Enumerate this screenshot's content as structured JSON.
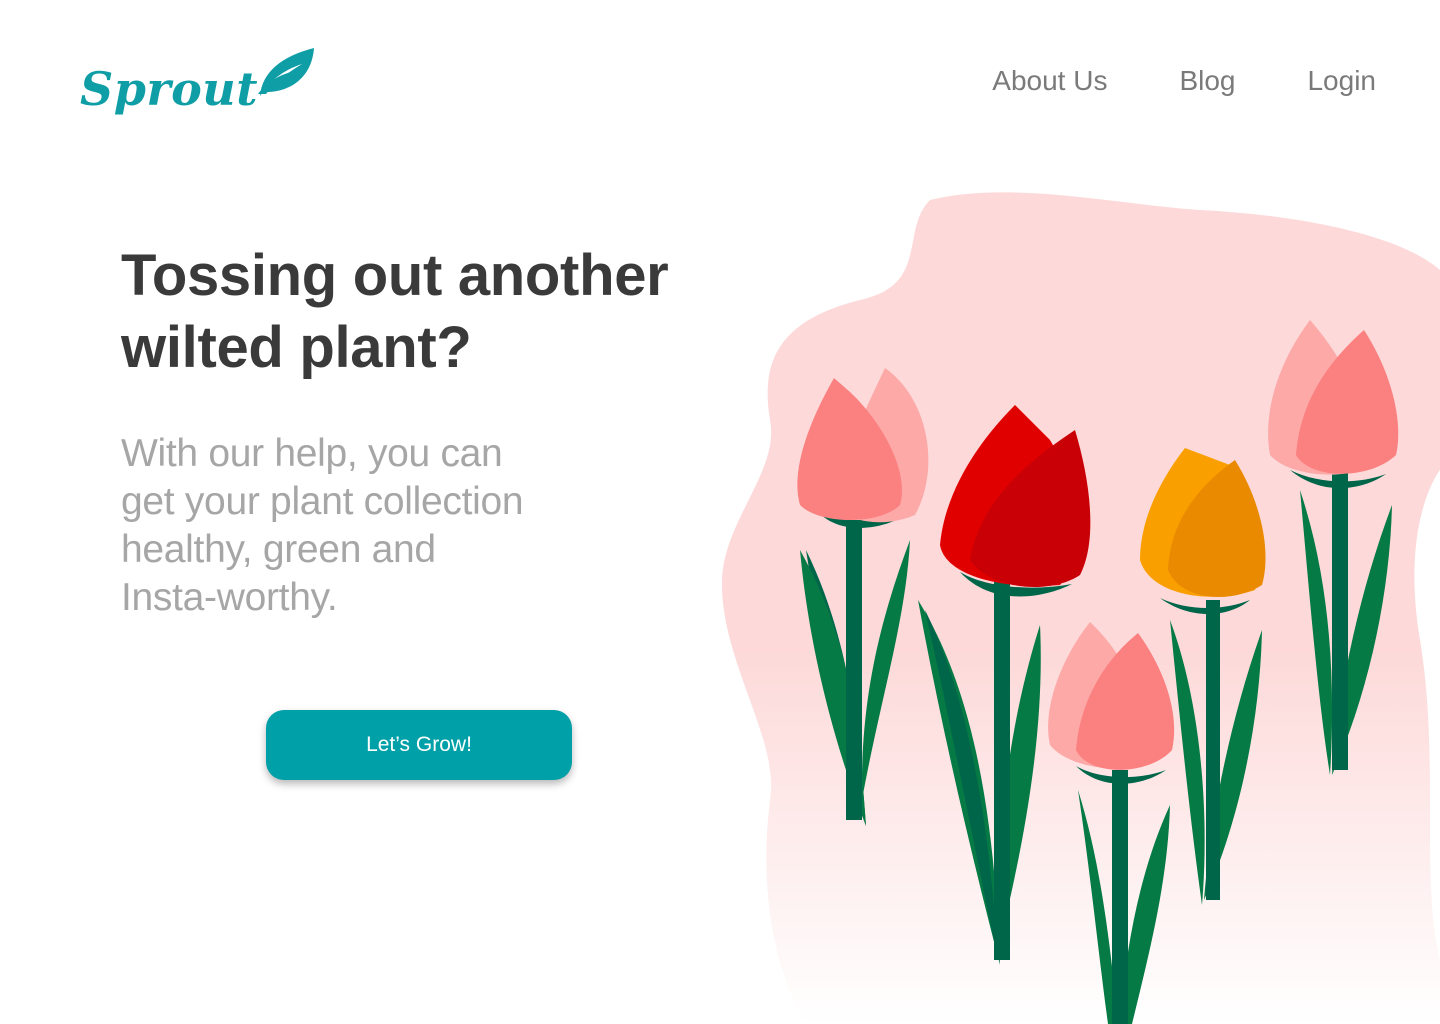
{
  "brand": {
    "name": "Sprout",
    "color": "#0f9ea6",
    "logo_icon": "leaf-icon"
  },
  "nav": {
    "items": [
      {
        "label": "About Us"
      },
      {
        "label": "Blog"
      },
      {
        "label": "Login"
      }
    ]
  },
  "hero": {
    "headline_line1": "Tossing out another",
    "headline_line2": "wilted plant?",
    "subtext_line1": "With our help, you can",
    "subtext_line2": "get your plant collection",
    "subtext_line3": "healthy, green and",
    "subtext_line4": "Insta-worthy.",
    "cta_label": "Let’s Grow!",
    "cta_color": "#00a0a8"
  },
  "illustration": {
    "blob_color": "#fdd9d9",
    "stem_color": "#057a45",
    "stem_dark_color": "#00664a",
    "tulip_colors": {
      "pink_light": "#fca9a8",
      "pink": "#fb8080",
      "red": "#e00000",
      "red_dark": "#c90006",
      "orange": "#f9a000",
      "orange_dark": "#ea8a00"
    }
  }
}
